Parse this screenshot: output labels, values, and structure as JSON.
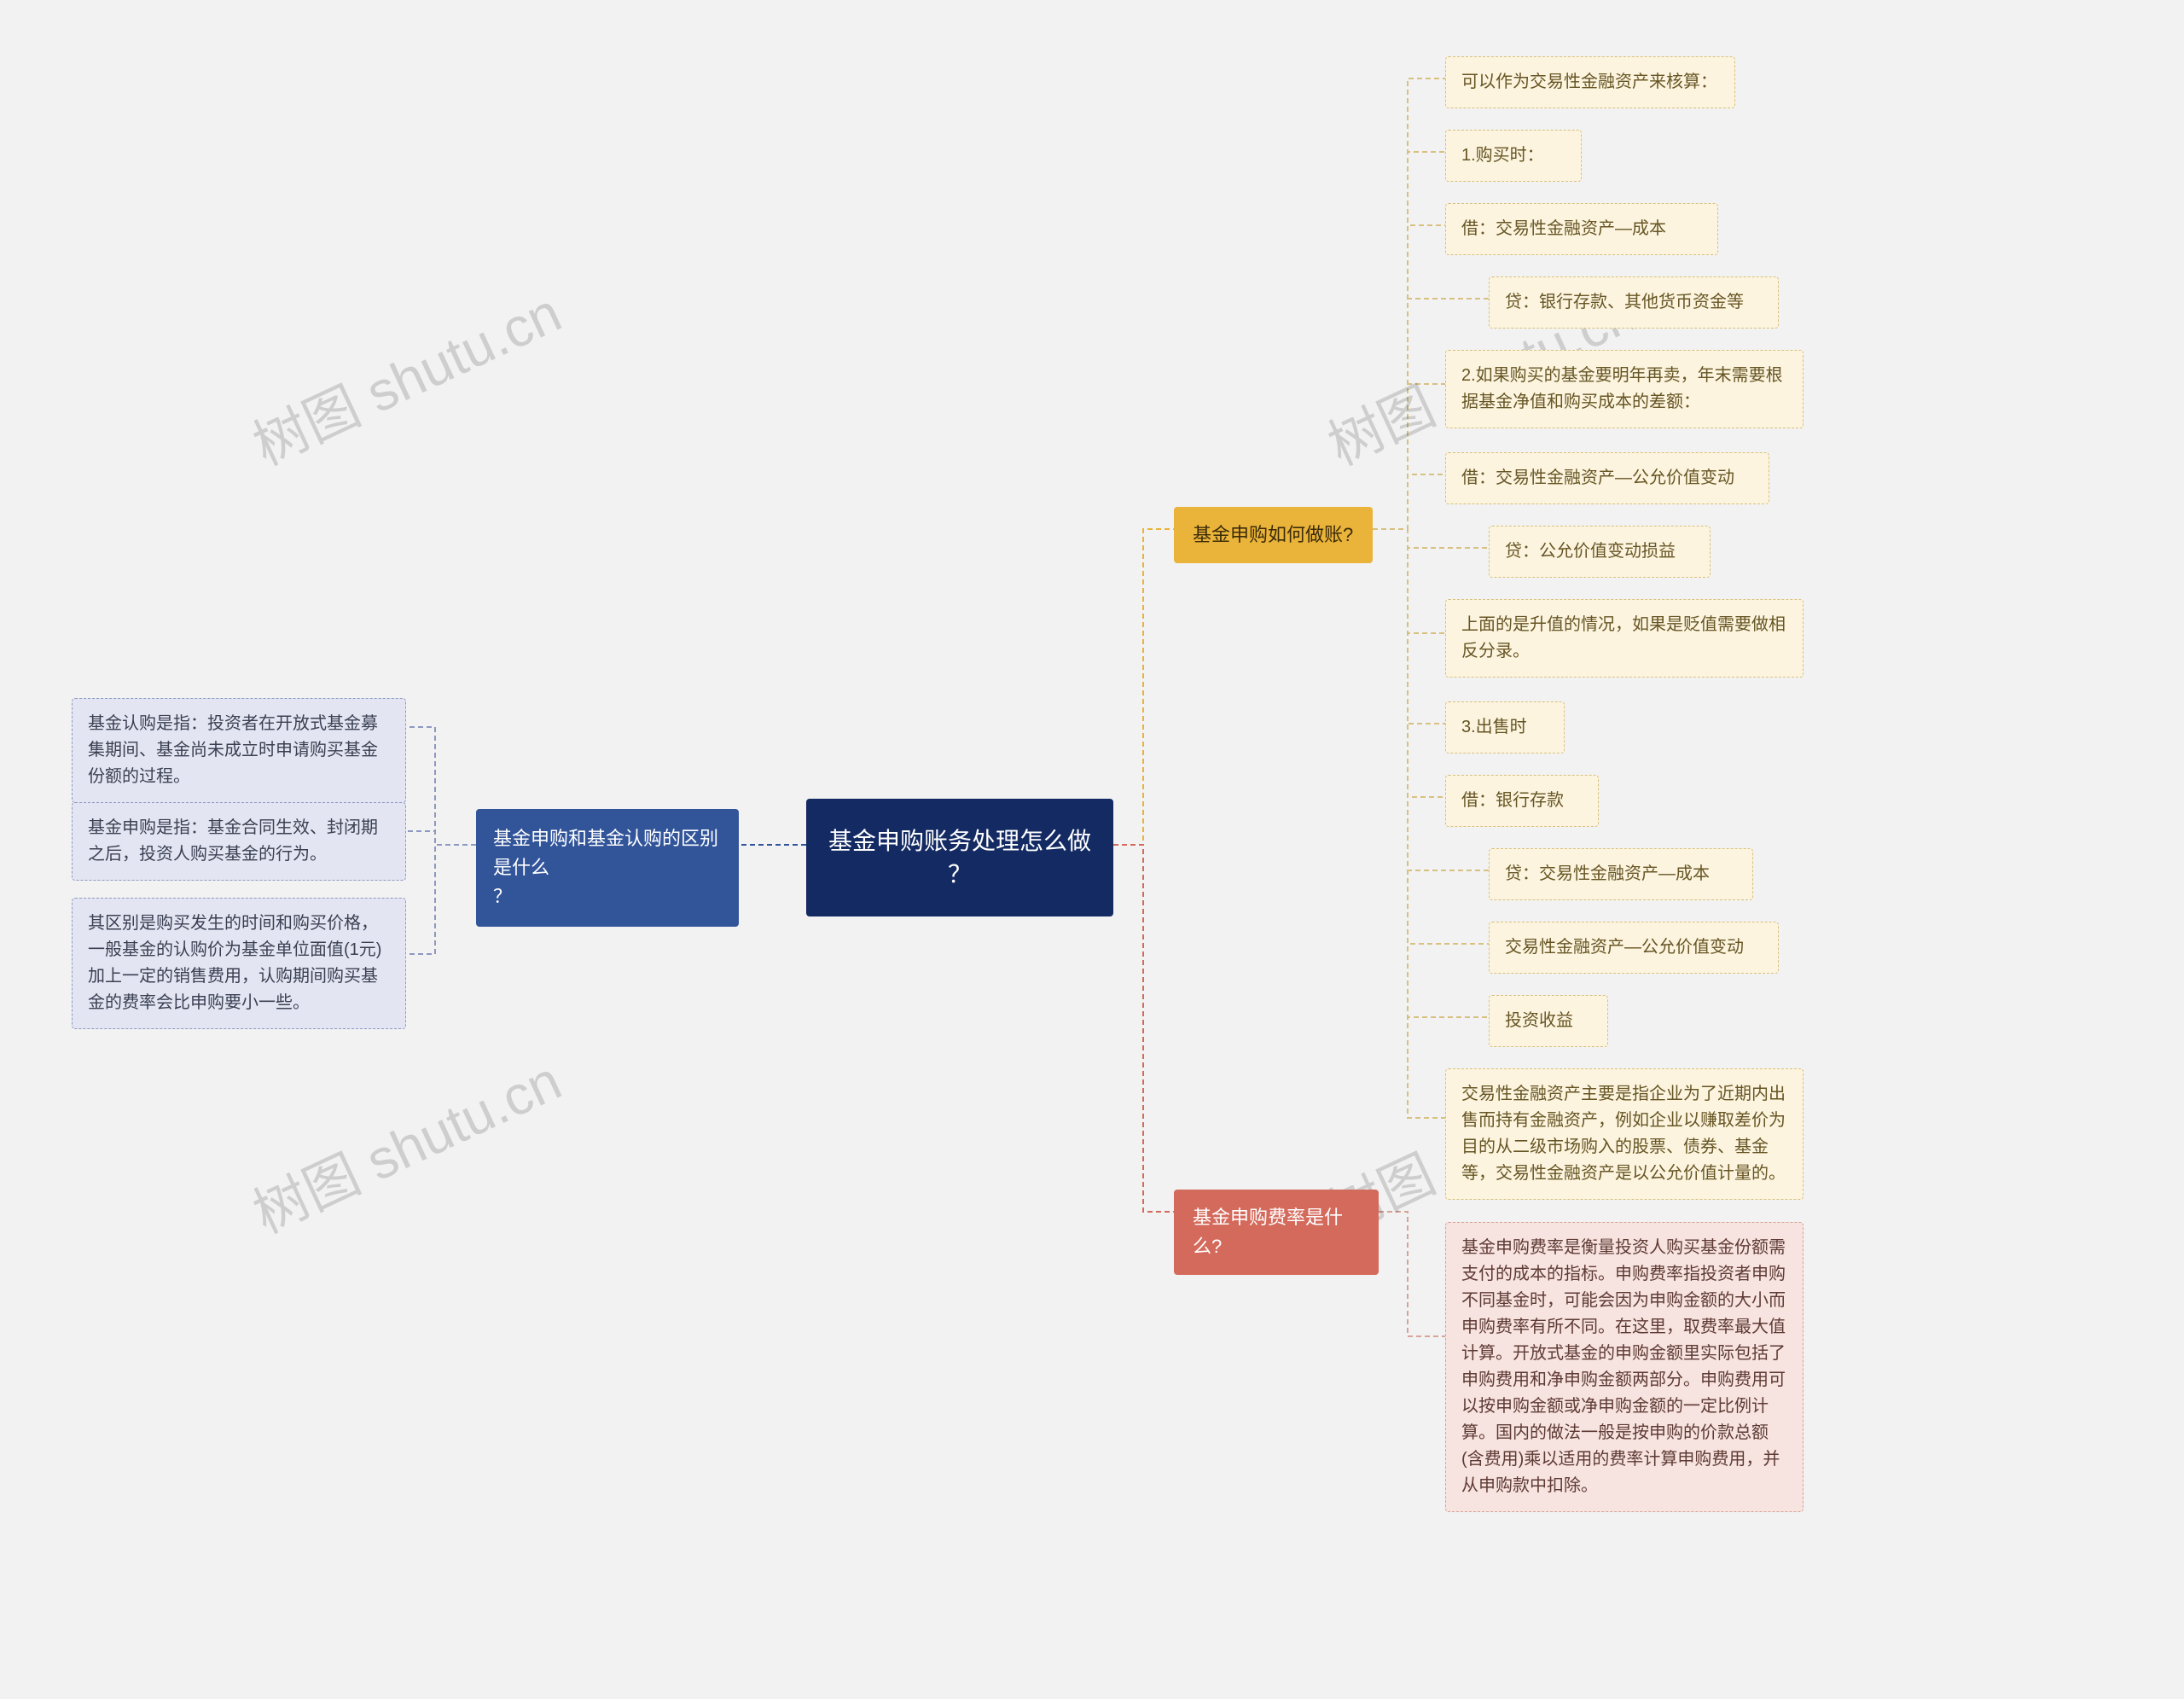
{
  "watermarks": {
    "nw": "树图 shutu.cn",
    "sw": "树图 shutu.cn",
    "ne": "树图 shutu.cn",
    "se": "树图 shutu.cn"
  },
  "root": {
    "line1": "基金申购账务处理怎么做",
    "line2": "？"
  },
  "left": {
    "branch": {
      "line1": "基金申购和基金认购的区别是什么",
      "line2": "？"
    },
    "leaves": [
      "基金认购是指：投资者在开放式基金募集期间、基金尚未成立时申请购买基金份额的过程。",
      "基金申购是指：基金合同生效、封闭期之后，投资人购买基金的行为。",
      "其区别是购买发生的时间和购买价格，一般基金的认购价为基金单位面值(1元)加上一定的销售费用，认购期间购买基金的费率会比申购要小一些。"
    ]
  },
  "gold": {
    "branch": "基金申购如何做账?",
    "leaves": [
      "可以作为交易性金融资产来核算：",
      "1.购买时：",
      "借：交易性金融资产—成本",
      "贷：银行存款、其他货币资金等",
      "2.如果购买的基金要明年再卖，年末需要根据基金净值和购买成本的差额：",
      "借：交易性金融资产—公允价值变动",
      "贷：公允价值变动损益",
      "上面的是升值的情况，如果是贬值需要做相反分录。",
      "3.出售时",
      "借：银行存款",
      "贷：交易性金融资产—成本",
      "交易性金融资产—公允价值变动",
      "投资收益",
      "交易性金融资产主要是指企业为了近期内出售而持有金融资产，例如企业以赚取差价为目的从二级市场购入的股票、债券、基金等，交易性金融资产是以公允价值计量的。"
    ]
  },
  "red": {
    "branch": "基金申购费率是什么?",
    "leaf": "基金申购费率是衡量投资人购买基金份额需支付的成本的指标。申购费率指投资者申购不同基金时，可能会因为申购金额的大小而申购费率有所不同。在这里，取费率最大值计算。开放式基金的申购金额里实际包括了申购费用和净申购金额两部分。申购费用可以按申购金额或净申购金额的一定比例计算。国内的做法一般是按申购的价款总额(含费用)乘以适用的费率计算申购费用，并从申购款中扣除。"
  }
}
